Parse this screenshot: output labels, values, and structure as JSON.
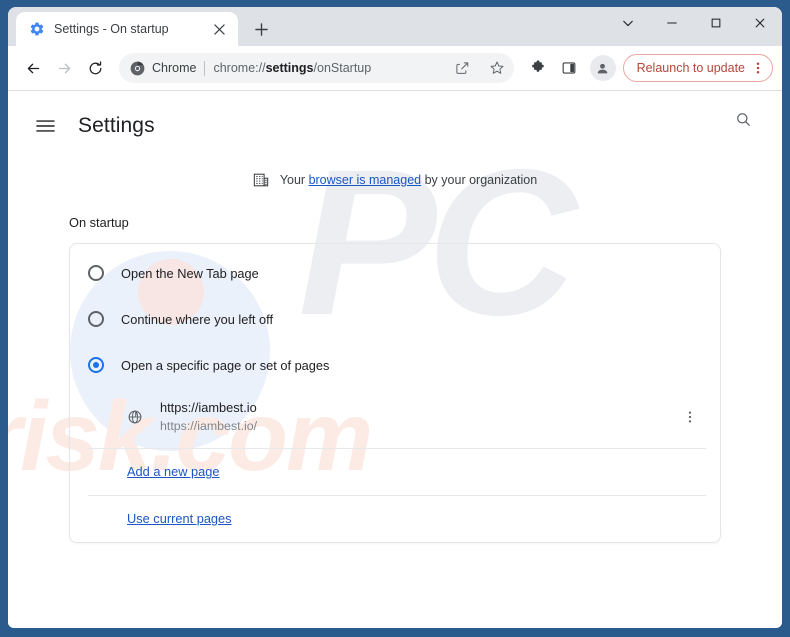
{
  "window": {
    "controls": [
      {
        "name": "tab-search-button",
        "glyph": "chevron-down"
      },
      {
        "name": "minimize-button",
        "glyph": "minimize"
      },
      {
        "name": "maximize-button",
        "glyph": "maximize"
      },
      {
        "name": "close-button",
        "glyph": "close"
      }
    ]
  },
  "tab": {
    "title": "Settings - On startup",
    "favicon": "gear-icon",
    "close_label": "×",
    "newtab_label": "+"
  },
  "toolbar": {
    "back_label": "←",
    "forward_label": "→",
    "reload_label": "⟳",
    "omnibox": {
      "brand": "Chrome",
      "url_prefix": "chrome://",
      "url_bold": "settings",
      "url_suffix": "/onStartup",
      "full_url": "chrome://settings/onStartup"
    },
    "relaunch": {
      "label": "Relaunch to update",
      "accent": "#b3463c",
      "border": "#e9a7a0"
    }
  },
  "settings": {
    "title": "Settings",
    "managed": {
      "prefix": "Your",
      "link": "browser is managed",
      "suffix": "by your organization",
      "link_color": "#1a56c4"
    },
    "section_title": "On startup",
    "options": [
      {
        "label": "Open the New Tab page",
        "checked": false
      },
      {
        "label": "Continue where you left off",
        "checked": false
      },
      {
        "label": "Open a specific page or set of pages",
        "checked": true
      }
    ],
    "accent": "#1a73e8",
    "startup_page": {
      "title": "https://iambest.io",
      "subtitle": "https://iambest.io/",
      "icon": "globe-icon"
    },
    "links": [
      {
        "label": "Add a new page"
      },
      {
        "label": "Use current pages"
      }
    ]
  },
  "watermark": {
    "big": "PC",
    "small": "risk.com"
  }
}
